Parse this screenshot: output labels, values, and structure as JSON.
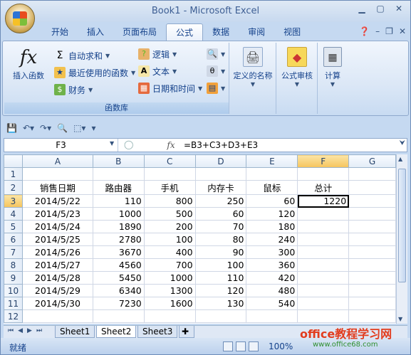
{
  "window": {
    "title": "Book1 - Microsoft Excel"
  },
  "tabs": [
    "开始",
    "插入",
    "页面布局",
    "公式",
    "数据",
    "审阅",
    "视图"
  ],
  "active_tab": "公式",
  "ribbon": {
    "function_library": {
      "label": "函数库",
      "insert_function": "插入函数",
      "autosum": "自动求和",
      "recent": "最近使用的函数",
      "financial": "财务",
      "logical": "逻辑",
      "text": "文本",
      "datetime": "日期和时间"
    },
    "defined_names": "定义的名称",
    "formula_auditing": "公式审核",
    "calculation": "计算"
  },
  "formula_bar": {
    "name_box": "F3",
    "formula": "=B3+C3+D3+E3",
    "fx": "fx"
  },
  "grid": {
    "columns": [
      "A",
      "B",
      "C",
      "D",
      "E",
      "F",
      "G"
    ],
    "header_row": [
      "销售日期",
      "路由器",
      "手机",
      "内存卡",
      "鼠标",
      "总计",
      ""
    ],
    "rows": [
      [
        "2014/5/22",
        "110",
        "800",
        "250",
        "60",
        "1220",
        ""
      ],
      [
        "2014/5/23",
        "1000",
        "500",
        "60",
        "120",
        "",
        ""
      ],
      [
        "2014/5/24",
        "1890",
        "200",
        "70",
        "180",
        "",
        ""
      ],
      [
        "2014/5/25",
        "2780",
        "100",
        "80",
        "240",
        "",
        ""
      ],
      [
        "2014/5/26",
        "3670",
        "400",
        "90",
        "300",
        "",
        ""
      ],
      [
        "2014/5/27",
        "4560",
        "700",
        "100",
        "360",
        "",
        ""
      ],
      [
        "2014/5/28",
        "5450",
        "1000",
        "110",
        "420",
        "",
        ""
      ],
      [
        "2014/5/29",
        "6340",
        "1300",
        "120",
        "480",
        "",
        ""
      ],
      [
        "2014/5/30",
        "7230",
        "1600",
        "130",
        "540",
        "",
        ""
      ]
    ],
    "row_numbers": [
      "1",
      "2",
      "3",
      "4",
      "5",
      "6",
      "7",
      "8",
      "9",
      "10",
      "11",
      "12"
    ]
  },
  "sheets": [
    "Sheet1",
    "Sheet2",
    "Sheet3"
  ],
  "active_sheet": "Sheet2",
  "status": {
    "text": "就绪",
    "zoom": "100%"
  },
  "watermark": {
    "main": "office教程学习网",
    "sub": "www.office68.com"
  }
}
